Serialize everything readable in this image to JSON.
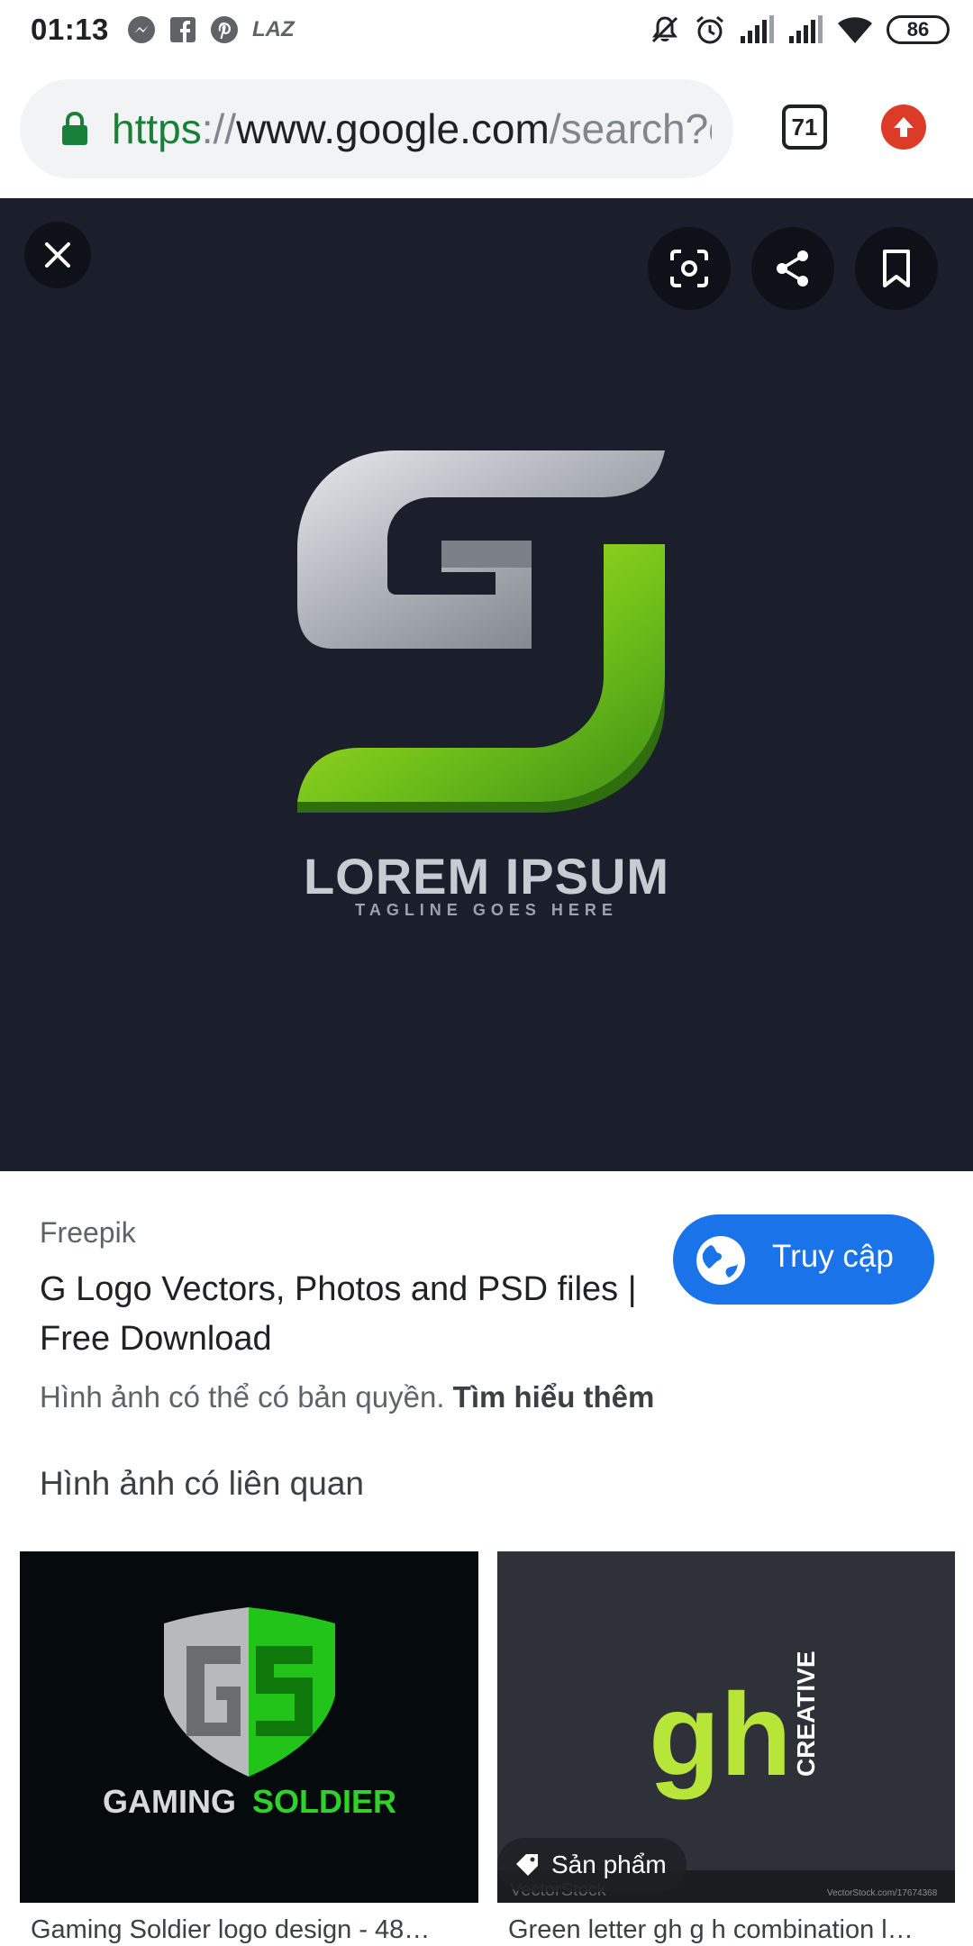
{
  "status_bar": {
    "time": "01:13",
    "left_icons": [
      "messenger-icon",
      "facebook-icon",
      "pinterest-icon",
      "lazada-icon"
    ],
    "lazada_text": "LAZ",
    "right_icons": [
      "mute-icon",
      "alarm-icon",
      "signal-icon",
      "signal-icon",
      "wifi-icon"
    ],
    "battery": "86"
  },
  "url_bar": {
    "scheme": "https",
    "separator": "://",
    "host": "www.google.com",
    "path": "/search?q",
    "tab_count": "71"
  },
  "viewer": {
    "logo_title": "LOREM IPSUM",
    "logo_tagline": "TAGLINE GOES HERE",
    "background": "#1b1f2b",
    "buttons": [
      "close-icon",
      "lens-icon",
      "share-icon",
      "bookmark-icon"
    ]
  },
  "result": {
    "source": "Freepik",
    "title": "G Logo Vectors, Photos and PSD files | Free Download",
    "visit_label": "Truy cập",
    "copyright_text": "Hình ảnh có thể có bản quyền.",
    "learn_more": "Tìm hiểu thêm"
  },
  "related": {
    "heading": "Hình ảnh có liên quan",
    "items": [
      {
        "caption": "Gaming Soldier logo design - 48…",
        "logo_text_a": "GAMING",
        "logo_text_b": "SOLDIER"
      },
      {
        "caption": "Green letter gh g h combination l…",
        "badge": "Sản phẩm",
        "logo_text": "gh",
        "side_text": "CREATIVE",
        "watermark": "VectorStock",
        "watermark_url": "VectorStock.com/17674368"
      }
    ]
  },
  "colors": {
    "accent_blue": "#1a73e8",
    "lock_green": "#188038",
    "update_red": "#db3b27",
    "logo_green": "#8ccc1a"
  }
}
